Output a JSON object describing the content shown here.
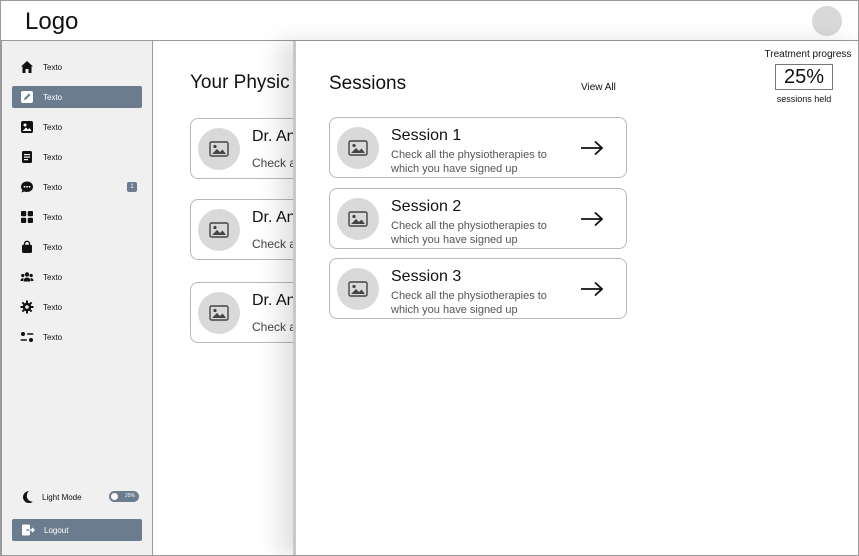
{
  "header": {
    "logo": "Logo"
  },
  "sidebar": {
    "items": [
      {
        "label": "Texto",
        "icon": "home-icon",
        "active": false
      },
      {
        "label": "Texto",
        "icon": "edit-icon",
        "active": true
      },
      {
        "label": "Texto",
        "icon": "image-icon",
        "active": false
      },
      {
        "label": "Texto",
        "icon": "document-icon",
        "active": false
      },
      {
        "label": "Texto",
        "icon": "chat-icon",
        "active": false,
        "badge": "1"
      },
      {
        "label": "Texto",
        "icon": "grid-icon",
        "active": false
      },
      {
        "label": "Texto",
        "icon": "bag-icon",
        "active": false
      },
      {
        "label": "Texto",
        "icon": "users-icon",
        "active": false
      },
      {
        "label": "Texto",
        "icon": "gear-icon",
        "active": false
      },
      {
        "label": "Texto",
        "icon": "sliders-icon",
        "active": false
      }
    ],
    "mode": {
      "label": "Light Mode",
      "toggle_text": "25%",
      "icon": "moon-icon"
    },
    "logout": {
      "label": "Logout",
      "icon": "logout-icon"
    }
  },
  "main": {
    "title": "Your Physic",
    "cards": [
      {
        "title": "Dr. An",
        "subtitle": "Check a"
      },
      {
        "title": "Dr. An",
        "subtitle": "Check a"
      },
      {
        "title": "Dr. An",
        "subtitle": "Check a"
      }
    ]
  },
  "panel": {
    "title": "Sessions",
    "view_all": "View All",
    "sessions": [
      {
        "title": "Session 1",
        "description": "Check all the physiotherapies to which you have signed up"
      },
      {
        "title": "Session 2",
        "description": "Check all the physiotherapies to which you have signed up"
      },
      {
        "title": "Session 3",
        "description": "Check all the physiotherapies to which you have signed up"
      }
    ]
  },
  "progress": {
    "heading": "Treatment progress",
    "value": "25%",
    "caption": "sessions held"
  },
  "colors": {
    "accent": "#6b7c8f",
    "placeholder": "#d9d9d9",
    "sidebar_bg": "#f0f0f0"
  }
}
